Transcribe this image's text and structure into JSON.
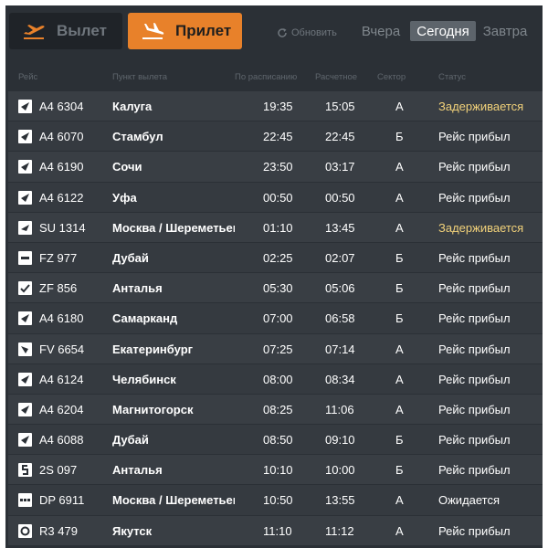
{
  "topbar": {
    "departures_label": "Вылет",
    "arrivals_label": "Прилет",
    "refresh_label": "Обновить",
    "day_yesterday": "Вчера",
    "day_today": "Сегодня",
    "day_tomorrow": "Завтра"
  },
  "colors": {
    "accent": "#e8812a",
    "board_bg": "#2b3036",
    "row_bg": "#393e44",
    "delayed": "#f2d27a"
  },
  "columns": {
    "flight": "Рейс",
    "from": "Пункт вылета",
    "scheduled": "По расписанию",
    "estimated": "Расчетное",
    "sector": "Сектор",
    "status": "Статус"
  },
  "flights": [
    {
      "airline_icon": "airline-logo-a4",
      "flight": "A4 6304",
      "from": "Калуга",
      "scheduled": "19:35",
      "estimated": "15:05",
      "sector": "А",
      "status": "Задерживается",
      "delayed": true
    },
    {
      "airline_icon": "airline-logo-a4",
      "flight": "A4 6070",
      "from": "Стамбул",
      "scheduled": "22:45",
      "estimated": "22:45",
      "sector": "Б",
      "status": "Рейс прибыл",
      "delayed": false
    },
    {
      "airline_icon": "airline-logo-a4",
      "flight": "A4 6190",
      "from": "Сочи",
      "scheduled": "23:50",
      "estimated": "03:17",
      "sector": "А",
      "status": "Рейс прибыл",
      "delayed": false
    },
    {
      "airline_icon": "airline-logo-a4",
      "flight": "A4 6122",
      "from": "Уфа",
      "scheduled": "00:50",
      "estimated": "00:50",
      "sector": "А",
      "status": "Рейс прибыл",
      "delayed": false
    },
    {
      "airline_icon": "airline-logo-su",
      "flight": "SU 1314",
      "from": "Москва / Шереметьево",
      "scheduled": "01:10",
      "estimated": "13:45",
      "sector": "А",
      "status": "Задерживается",
      "delayed": true
    },
    {
      "airline_icon": "airline-logo-fz",
      "flight": "FZ 977",
      "from": "Дубай",
      "scheduled": "02:25",
      "estimated": "02:07",
      "sector": "Б",
      "status": "Рейс прибыл",
      "delayed": false
    },
    {
      "airline_icon": "airline-logo-zf",
      "flight": "ZF 856",
      "from": "Анталья",
      "scheduled": "05:30",
      "estimated": "05:06",
      "sector": "Б",
      "status": "Рейс прибыл",
      "delayed": false
    },
    {
      "airline_icon": "airline-logo-a4",
      "flight": "A4 6180",
      "from": "Самарканд",
      "scheduled": "07:00",
      "estimated": "06:58",
      "sector": "Б",
      "status": "Рейс прибыл",
      "delayed": false
    },
    {
      "airline_icon": "airline-logo-fv",
      "flight": "FV 6654",
      "from": "Екатеринбург",
      "scheduled": "07:25",
      "estimated": "07:14",
      "sector": "А",
      "status": "Рейс прибыл",
      "delayed": false
    },
    {
      "airline_icon": "airline-logo-a4",
      "flight": "A4 6124",
      "from": "Челябинск",
      "scheduled": "08:00",
      "estimated": "08:34",
      "sector": "А",
      "status": "Рейс прибыл",
      "delayed": false
    },
    {
      "airline_icon": "airline-logo-a4",
      "flight": "A4 6204",
      "from": "Магнитогорск",
      "scheduled": "08:25",
      "estimated": "11:06",
      "sector": "А",
      "status": "Рейс прибыл",
      "delayed": false
    },
    {
      "airline_icon": "airline-logo-a4",
      "flight": "A4 6088",
      "from": "Дубай",
      "scheduled": "08:50",
      "estimated": "09:10",
      "sector": "Б",
      "status": "Рейс прибыл",
      "delayed": false
    },
    {
      "airline_icon": "airline-logo-2s",
      "flight": "2S 097",
      "from": "Анталья",
      "scheduled": "10:10",
      "estimated": "10:00",
      "sector": "Б",
      "status": "Рейс прибыл",
      "delayed": false
    },
    {
      "airline_icon": "airline-logo-dp",
      "flight": "DP 6911",
      "from": "Москва / Шереметьево",
      "scheduled": "10:50",
      "estimated": "13:55",
      "sector": "А",
      "status": "Ожидается",
      "delayed": false
    },
    {
      "airline_icon": "airline-logo-r3",
      "flight": "R3 479",
      "from": "Якутск",
      "scheduled": "11:10",
      "estimated": "11:12",
      "sector": "А",
      "status": "Рейс прибыл",
      "delayed": false
    }
  ]
}
